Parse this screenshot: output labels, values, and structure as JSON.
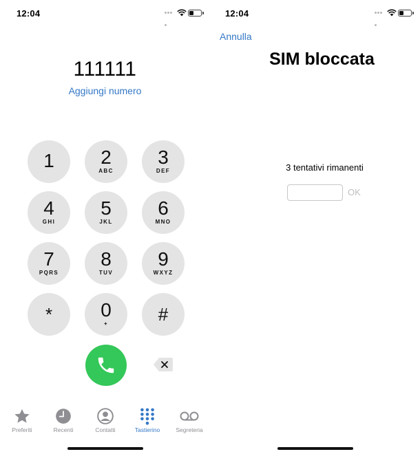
{
  "left_screen": {
    "status_bar": {
      "time": "12:04"
    },
    "dialer": {
      "number": "111111",
      "add_number_label": "Aggiungi numero",
      "keys": [
        {
          "digit": "1",
          "letters": ""
        },
        {
          "digit": "2",
          "letters": "ABC"
        },
        {
          "digit": "3",
          "letters": "DEF"
        },
        {
          "digit": "4",
          "letters": "GHI"
        },
        {
          "digit": "5",
          "letters": "JKL"
        },
        {
          "digit": "6",
          "letters": "MNO"
        },
        {
          "digit": "7",
          "letters": "PQRS"
        },
        {
          "digit": "8",
          "letters": "TUV"
        },
        {
          "digit": "9",
          "letters": "WXYZ"
        },
        {
          "digit": "*",
          "letters": ""
        },
        {
          "digit": "0",
          "letters": "+"
        },
        {
          "digit": "#",
          "letters": ""
        }
      ],
      "call_icon": "phone-icon",
      "delete_icon": "delete-backspace-icon"
    },
    "tab_bar": {
      "tabs": [
        {
          "label": "Preferiti",
          "icon": "star-icon",
          "active": false
        },
        {
          "label": "Recenti",
          "icon": "clock-icon",
          "active": false
        },
        {
          "label": "Contatti",
          "icon": "contact-icon",
          "active": false
        },
        {
          "label": "Tastierino",
          "icon": "keypad-icon",
          "active": true
        },
        {
          "label": "Segreteria",
          "icon": "voicemail-icon",
          "active": false
        }
      ]
    }
  },
  "right_screen": {
    "status_bar": {
      "time": "12:04"
    },
    "cancel_label": "Annulla",
    "title": "SIM bloccata",
    "attempts_text": "3 tentativi rimanenti",
    "pin_input": {
      "value": "",
      "placeholder": ""
    },
    "ok_label": "OK"
  },
  "colors": {
    "accent": "#3478c6",
    "call_green": "#34c759",
    "key_bg": "#e4e4e4",
    "inactive_gray": "#8e8e93"
  }
}
